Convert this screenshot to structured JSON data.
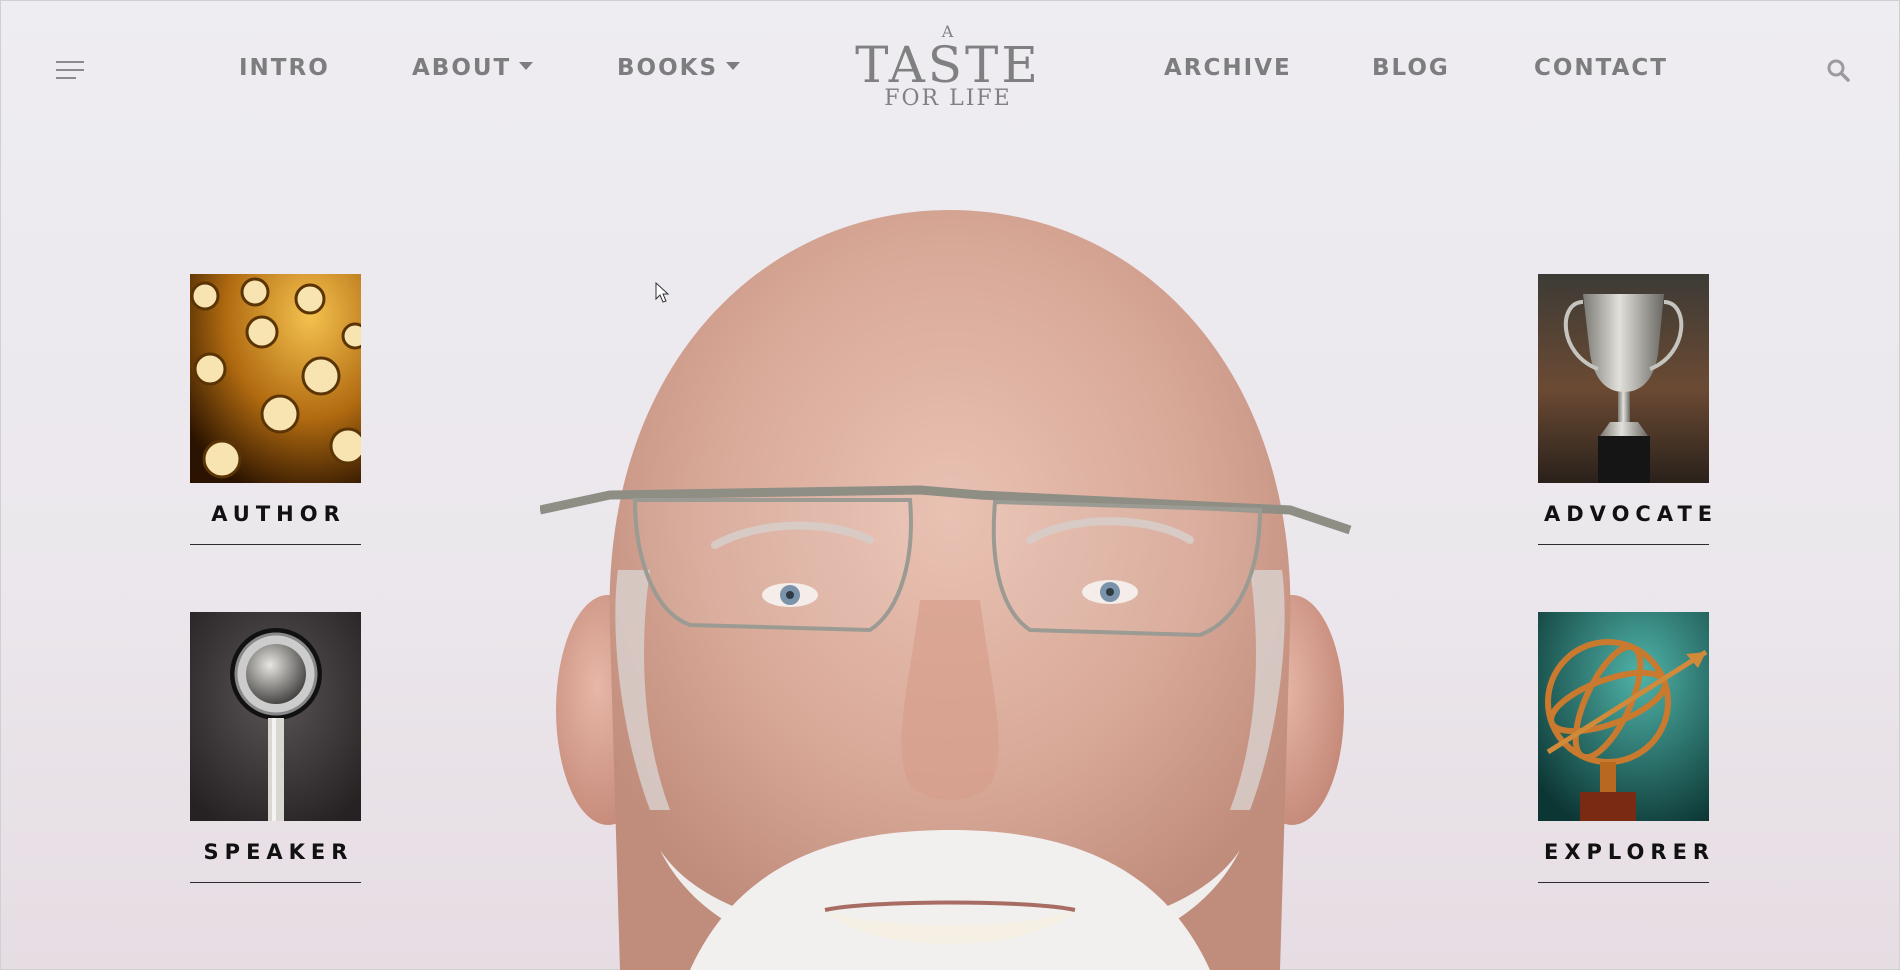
{
  "nav": {
    "intro": "INTRO",
    "about": "ABOUT",
    "books": "BOOKS",
    "archive": "ARCHIVE",
    "blog": "BLOG",
    "contact": "CONTACT"
  },
  "logo": {
    "line1": "A",
    "line2": "TASTE",
    "line3": "FOR LIFE"
  },
  "icons": {
    "menu": "hamburger-menu-icon",
    "search": "search-icon",
    "dropdown": "caret-down-icon"
  },
  "tiles": [
    {
      "label": "AUTHOR",
      "image": "typewriter-keys"
    },
    {
      "label": "ADVOCATE",
      "image": "silver-trophy"
    },
    {
      "label": "SPEAKER",
      "image": "vintage-microphone"
    },
    {
      "label": "EXPLORER",
      "image": "armillary-sphere"
    }
  ],
  "colors": {
    "nav_text": "#7d7d80",
    "tile_label": "#111111",
    "background": "#ecebef"
  }
}
